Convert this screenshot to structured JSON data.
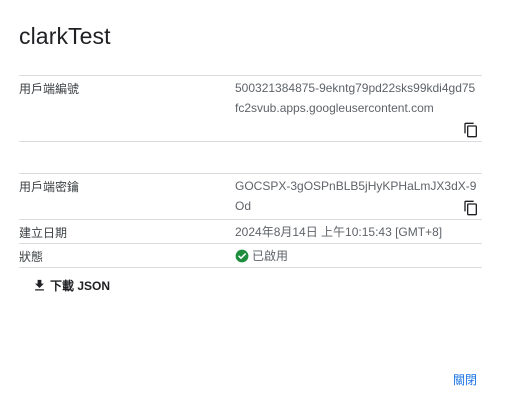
{
  "dialog": {
    "title": "clarkTest",
    "close_label": "關閉"
  },
  "client_id": {
    "label": "用戶端編號",
    "value": "500321384875-9ekntg79pd22sks99kdi4gd75fc2svub.apps.googleusercontent.com",
    "copy_icon": "copy-icon"
  },
  "client_secret": {
    "label": "用戶端密鑰",
    "value": "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",
    "copy_icon": "copy-icon"
  },
  "created": {
    "label": "建立日期",
    "value": "2024年8月14日 上午10:15:43 [GMT+8]"
  },
  "status": {
    "label": "狀態",
    "value": "已啟用",
    "icon": "check-circle-icon",
    "color": "#1e8e3e"
  },
  "download": {
    "label": "下載 JSON",
    "icon": "download-icon"
  },
  "colors": {
    "accent": "#1a73e8",
    "divider": "#dadce0"
  }
}
